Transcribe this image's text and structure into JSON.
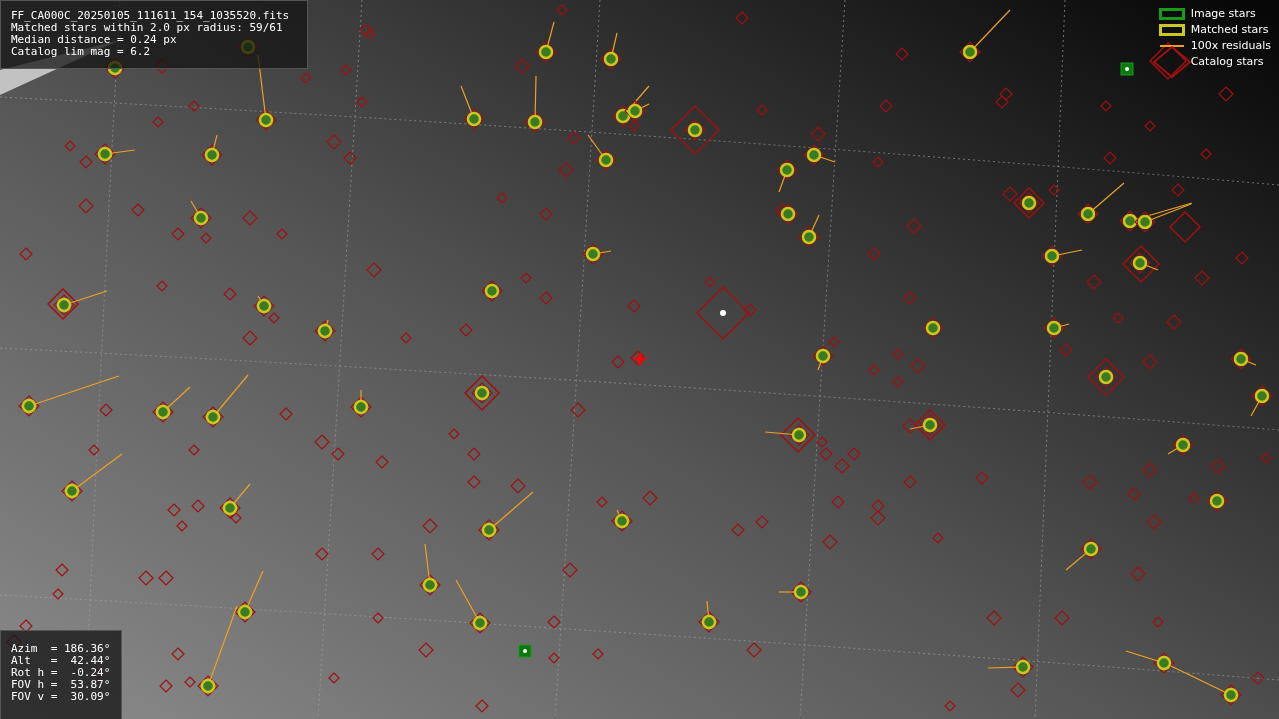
{
  "info_lines": [
    "FF_CA000C_20250105_111611_154_1035520.fits",
    "Matched stars within 2.0 px radius: 59/61",
    "Median distance = 0.24 px",
    "Catalog lim mag = 6.2"
  ],
  "legend": [
    {
      "kind": "box",
      "label": "Image stars",
      "color": "#1a9a1a"
    },
    {
      "kind": "box",
      "label": "Matched stars",
      "color": "#c8c81e"
    },
    {
      "kind": "line",
      "label": "100x residuals",
      "color": "#f0a020"
    },
    {
      "kind": "diamond",
      "label": "Catalog stars",
      "color": "#a01010"
    }
  ],
  "pointing_lines": [
    "Azim  = 186.36°",
    "Alt   =  42.44°",
    "Rot h =  -0.24°",
    "FOV h =  53.87°",
    "FOV v =  30.09°"
  ]
}
